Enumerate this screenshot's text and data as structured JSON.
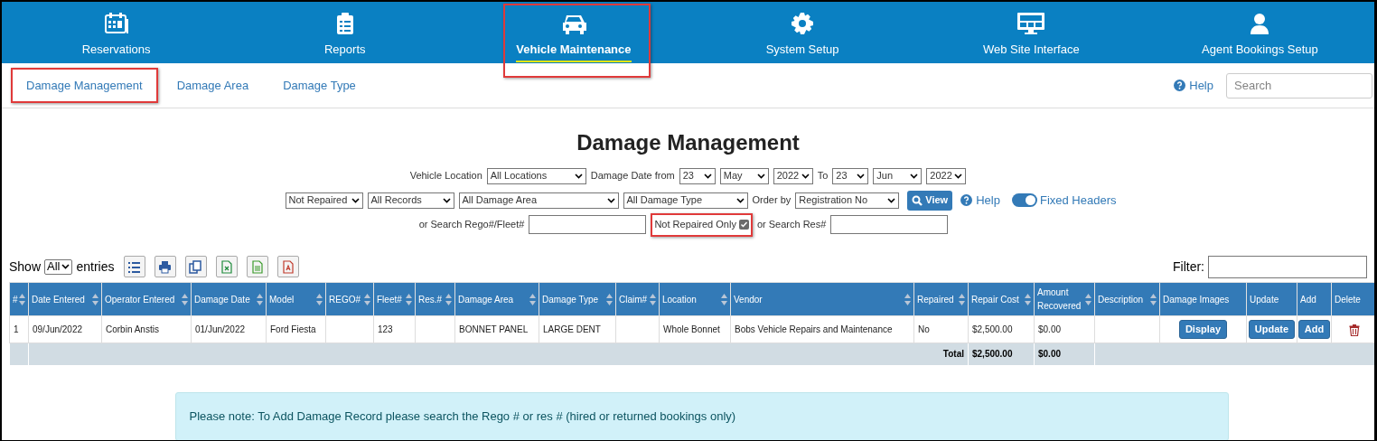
{
  "nav": [
    {
      "label": "Reservations",
      "selected": false,
      "highlighted": false
    },
    {
      "label": "Reports",
      "selected": false,
      "highlighted": false
    },
    {
      "label": "Vehicle Maintenance",
      "selected": true,
      "highlighted": true
    },
    {
      "label": "System Setup",
      "selected": false,
      "highlighted": false
    },
    {
      "label": "Web Site Interface",
      "selected": false,
      "highlighted": false
    },
    {
      "label": "Agent Bookings Setup",
      "selected": false,
      "highlighted": false
    }
  ],
  "subtabs": [
    {
      "label": "Damage Management",
      "highlighted": true
    },
    {
      "label": "Damage Area",
      "highlighted": false
    },
    {
      "label": "Damage Type",
      "highlighted": false
    }
  ],
  "help": "Help",
  "search": {
    "placeholder": "Search"
  },
  "title": "Damage Management",
  "filters": {
    "vehicle_location_label": "Vehicle Location",
    "vehicle_location": "All Locations",
    "damage_date_from_label": "Damage Date from",
    "from_day": "23",
    "from_month": "May",
    "from_year": "2022",
    "to_label": "To",
    "to_day": "23",
    "to_month": "Jun",
    "to_year": "2022",
    "repair_status": "Not Repaired",
    "records": "All Records",
    "damage_area": "All Damage Area",
    "damage_type": "All Damage Type",
    "order_by_label": "Order by",
    "order_by": "Registration No",
    "view_button": "View",
    "help": "Help",
    "fixed_headers": {
      "label": "Fixed Headers",
      "on": true
    },
    "rego_label": "or Search Rego#/Fleet#",
    "not_repaired_only": {
      "label": "Not Repaired Only",
      "checked": true,
      "highlighted": true
    },
    "res_label": "or Search Res#"
  },
  "show_label": "Show",
  "show_value": "All",
  "entries_label": "entries",
  "filter_label": "Filter:",
  "table": {
    "columns": [
      "#",
      "Date Entered",
      "Operator Entered",
      "Damage Date",
      "Model",
      "REGO#",
      "Fleet#",
      "Res.#",
      "Damage Area",
      "Damage Type",
      "Claim#",
      "Location",
      "Vendor",
      "Repaired",
      "Repair Cost",
      "Amount Recovered",
      "Description",
      "Damage Images",
      "Update",
      "Add",
      "Delete"
    ],
    "rows": [
      {
        "cells": [
          "1",
          "09/Jun/2022",
          "Corbin Anstis",
          "01/Jun/2022",
          "Ford Fiesta",
          "",
          "123",
          "",
          "BONNET PANEL",
          "LARGE DENT",
          "",
          "Whole Bonnet",
          "Bobs Vehicle Repairs and Maintenance",
          "No",
          "$2,500.00",
          "$0.00",
          ""
        ],
        "display_button": "Display",
        "update_button": "Update",
        "add_button": "Add"
      }
    ],
    "total_label": "Total",
    "total_repair_cost": "$2,500.00",
    "total_recovered": "$0.00"
  },
  "note": "Please note: To Add Damage Record please search the Rego # or res # (hired or returned bookings only)"
}
